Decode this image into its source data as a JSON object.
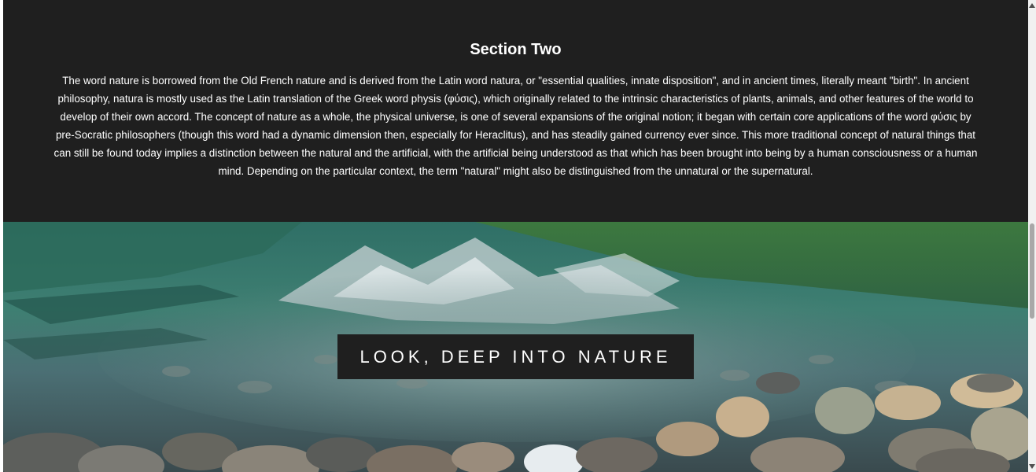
{
  "section": {
    "title": "Section Two",
    "body": "The word nature is borrowed from the Old French nature and is derived from the Latin word natura, or \"essential qualities, innate disposition\", and in ancient times, literally meant \"birth\". In ancient philosophy, natura is mostly used as the Latin translation of the Greek word physis (φύσις), which originally related to the intrinsic characteristics of plants, animals, and other features of the world to develop of their own accord. The concept of nature as a whole, the physical universe, is one of several expansions of the original notion; it began with certain core applications of the word φύσις by pre-Socratic philosophers (though this word had a dynamic dimension then, especially for Heraclitus), and has steadily gained currency ever since. This more traditional concept of natural things that can still be found today implies a distinction between the natural and the artificial, with the artificial being understood as that which has been brought into being by a human consciousness or a human mind. Depending on the particular context, the term \"natural\" might also be distinguished from the unnatural or the supernatural."
  },
  "hero": {
    "caption": "LOOK, DEEP INTO NATURE",
    "image": "mountain-lake-with-rocky-shore"
  },
  "colors": {
    "section_background": "#1f1f1f",
    "caption_background": "#1f1f1f",
    "text": "#ffffff"
  }
}
